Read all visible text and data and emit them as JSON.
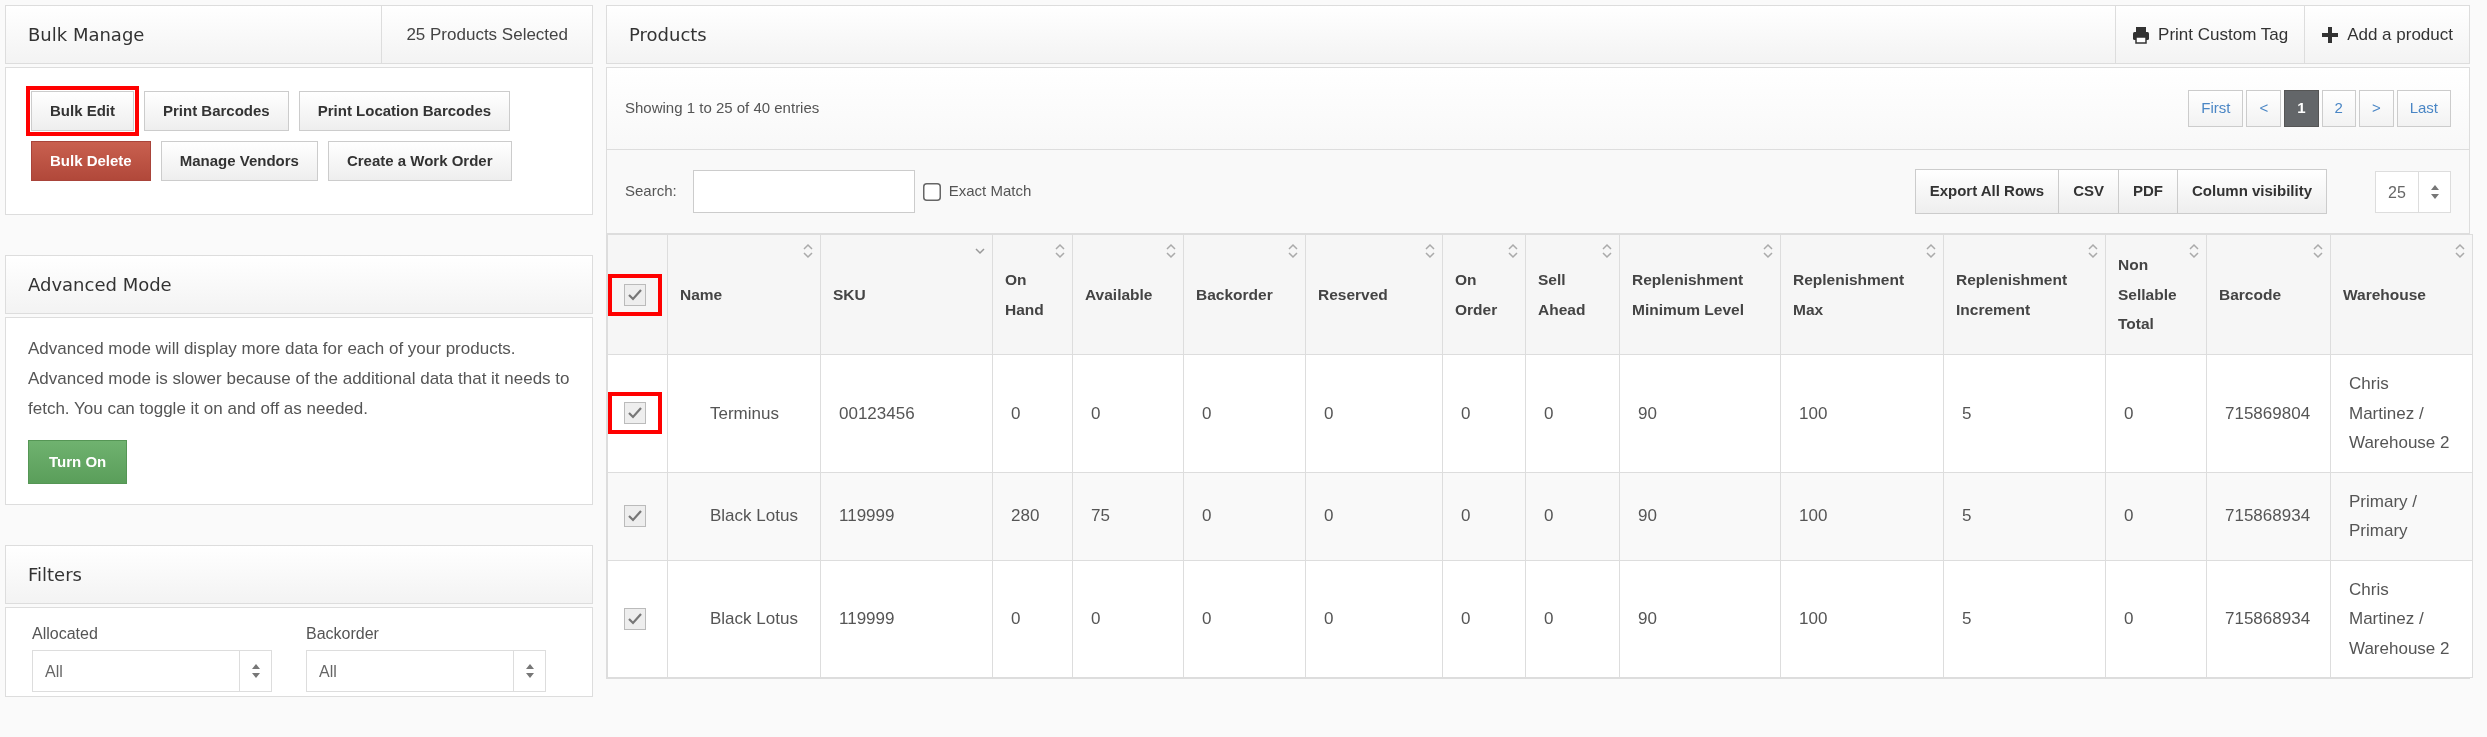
{
  "bulk_manage": {
    "title": "Bulk Manage",
    "selected_count": "25 Products Selected",
    "button_rows": [
      [
        {
          "label": "Bulk Edit",
          "kind": "default",
          "highlighted": true
        },
        {
          "label": "Print Barcodes",
          "kind": "default",
          "highlighted": false
        },
        {
          "label": "Print Location Barcodes",
          "kind": "default",
          "highlighted": false
        }
      ],
      [
        {
          "label": "Bulk Delete",
          "kind": "danger",
          "highlighted": false
        },
        {
          "label": "Manage Vendors",
          "kind": "default",
          "highlighted": false
        },
        {
          "label": "Create a Work Order",
          "kind": "default",
          "highlighted": false
        }
      ]
    ]
  },
  "advanced_mode": {
    "title": "Advanced Mode",
    "description": "Advanced mode will display more data for each of your products. Advanced mode is slower because of the additional data that it needs to fetch. You can toggle it on and off as needed.",
    "button": "Turn On"
  },
  "filters": {
    "title": "Filters",
    "fields": [
      {
        "label": "Allocated",
        "value": "All"
      },
      {
        "label": "Backorder",
        "value": "All"
      }
    ]
  },
  "products": {
    "title": "Products",
    "actions": [
      {
        "label": "Print Custom Tag",
        "kind": "print"
      },
      {
        "label": "Add a product",
        "kind": "add"
      }
    ],
    "info": "Showing 1 to 25 of 40 entries",
    "pagination": [
      {
        "label": "First",
        "selected": false
      },
      {
        "label": "<",
        "selected": false
      },
      {
        "label": "1",
        "selected": true
      },
      {
        "label": "2",
        "selected": false
      },
      {
        "label": ">",
        "selected": false
      },
      {
        "label": "Last",
        "selected": false
      }
    ],
    "search": {
      "label": "Search:"
    },
    "exact_match": {
      "label": "Exact Match",
      "checked": false
    },
    "export_buttons": [
      "Export All Rows",
      "CSV",
      "PDF",
      "Column visibility"
    ],
    "page_length": "25",
    "table": {
      "select_all": {
        "checked": true,
        "highlighted": true
      },
      "columns": [
        {
          "label": "Name",
          "sorted_descending": false
        },
        {
          "label": "SKU",
          "sorted_descending": true
        },
        {
          "label": "On Hand",
          "sorted_descending": false
        },
        {
          "label": "Available",
          "sorted_descending": false
        },
        {
          "label": "Backorder",
          "sorted_descending": false
        },
        {
          "label": "Reserved",
          "sorted_descending": false
        },
        {
          "label": "On Order",
          "sorted_descending": false
        },
        {
          "label": "Sell Ahead",
          "sorted_descending": false
        },
        {
          "label": "Replenishment Minimum Level",
          "sorted_descending": false
        },
        {
          "label": "Replenishment Max",
          "sorted_descending": false
        },
        {
          "label": "Replenishment Increment",
          "sorted_descending": false
        },
        {
          "label": "Non Sellable Total",
          "sorted_descending": false
        },
        {
          "label": "Barcode",
          "sorted_descending": false
        },
        {
          "label": "Warehouse",
          "sorted_descending": false
        }
      ],
      "rows": [
        {
          "checked": true,
          "highlighted": true,
          "cells": [
            "Terminus",
            "00123456",
            "0",
            "0",
            "0",
            "0",
            "0",
            "0",
            "90",
            "100",
            "5",
            "0",
            "715869804",
            "Chris Martinez / Warehouse 2"
          ]
        },
        {
          "checked": true,
          "highlighted": false,
          "cells": [
            "Black Lotus",
            "119999",
            "280",
            "75",
            "0",
            "0",
            "0",
            "0",
            "90",
            "100",
            "5",
            "0",
            "715868934",
            "Primary / Primary"
          ]
        },
        {
          "checked": true,
          "highlighted": false,
          "cells": [
            "Black Lotus",
            "119999",
            "0",
            "0",
            "0",
            "0",
            "0",
            "0",
            "90",
            "100",
            "5",
            "0",
            "715868934",
            "Chris Martinez / Warehouse 2"
          ]
        }
      ]
    }
  }
}
